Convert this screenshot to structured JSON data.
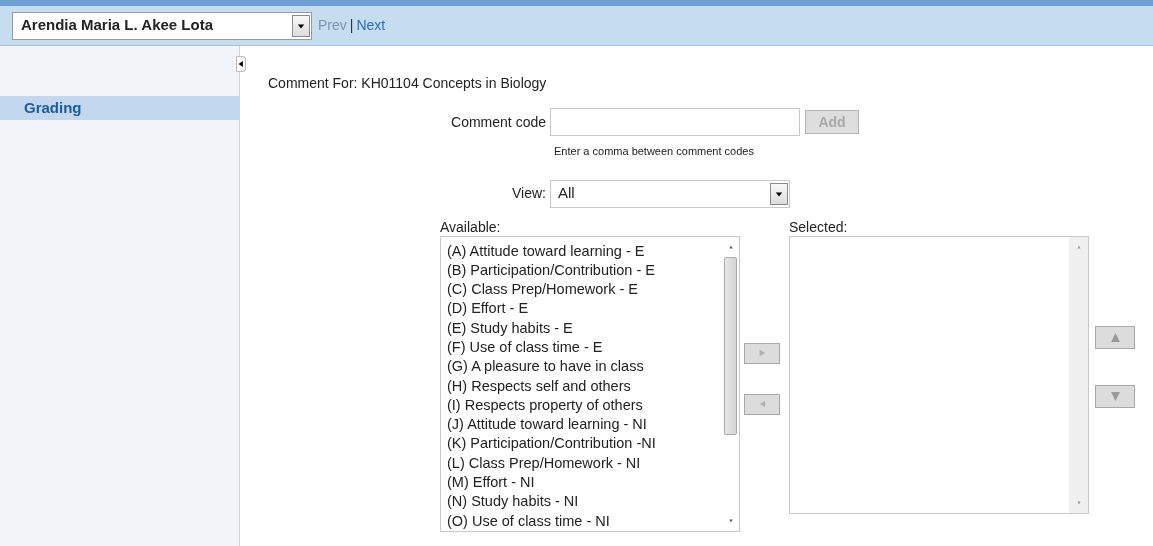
{
  "header": {
    "student_select": {
      "value": "Arendia Maria L. Akee Lota"
    },
    "nav": [
      {
        "label": "Prev",
        "disabled": true
      },
      {
        "label": "|",
        "kind": "separator"
      },
      {
        "label": "Next",
        "disabled": false
      }
    ]
  },
  "sidebar": {
    "items": [
      {
        "label": "Grading",
        "selected": true
      }
    ]
  },
  "content": {
    "title": "Comment For: KH01104 Concepts in Biology",
    "comment_code": {
      "label": "Comment code",
      "add_button": {
        "label": "Add",
        "disabled": true
      },
      "hint": "Enter a comma between comment codes"
    },
    "view": {
      "label": "View:",
      "value": "All"
    },
    "available": {
      "label": "Available:",
      "items": [
        "(A) Attitude toward learning - E",
        "(B) Participation/Contribution - E",
        "(C) Class Prep/Homework - E",
        "(D) Effort - E",
        "(E) Study habits - E",
        "(F) Use of class time - E",
        "(G) A pleasure to have in class",
        "(H) Respects self and others",
        "(I) Respects property of others",
        "(J) Attitude toward learning - NI",
        "(K) Participation/Contribution -NI",
        "(L) Class Prep/Homework - NI",
        "(M) Effort - NI",
        "(N) Study habits - NI",
        "(O) Use of class time - NI"
      ]
    },
    "transfer_buttons": [
      {
        "kind": "right",
        "disabled": true
      },
      {
        "kind": "left",
        "disabled": true
      }
    ],
    "selected": {
      "label": "Selected:"
    },
    "order_buttons": [
      {
        "kind": "up",
        "disabled": true
      },
      {
        "kind": "down",
        "disabled": true
      }
    ]
  }
}
